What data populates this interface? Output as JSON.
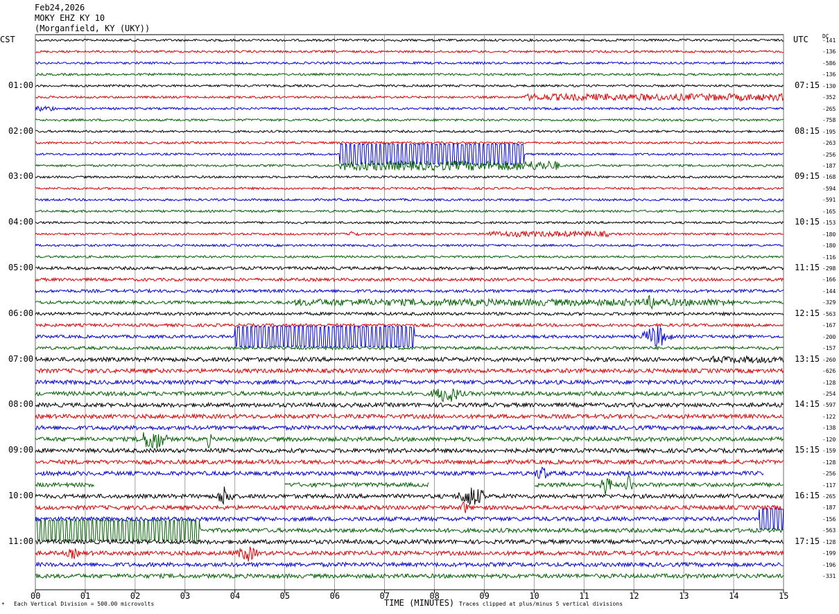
{
  "header": {
    "date": "Feb24,2026",
    "station": "MOKY EHZ KY 10",
    "location": "(Morganfield, KY (UKY))"
  },
  "left_tz": "CST",
  "right_tz": "UTC",
  "dc_label": "DC",
  "colors": [
    "#000000",
    "#e00000",
    "#0000e0",
    "#006000"
  ],
  "footer": {
    "xlabel": "TIME (MINUTES)",
    "scale_note": "Each Vertical Division =  500.00 microvolts",
    "clip_note": "Traces clipped at plus/minus 5 vertical divisions"
  },
  "chart_data": {
    "type": "line",
    "title": "MOKY EHZ KY 10",
    "xlabel": "TIME (MINUTES)",
    "xlim": [
      0,
      15
    ],
    "x_ticks": [
      "00",
      "01",
      "02",
      "03",
      "04",
      "05",
      "06",
      "07",
      "08",
      "09",
      "10",
      "11",
      "12",
      "13",
      "14",
      "15"
    ],
    "rows": 48,
    "left_hour_labels": [
      {
        "row": 4,
        "label": "01:00"
      },
      {
        "row": 8,
        "label": "02:00"
      },
      {
        "row": 12,
        "label": "03:00"
      },
      {
        "row": 16,
        "label": "04:00"
      },
      {
        "row": 20,
        "label": "05:00"
      },
      {
        "row": 24,
        "label": "06:00"
      },
      {
        "row": 28,
        "label": "07:00"
      },
      {
        "row": 32,
        "label": "08:00"
      },
      {
        "row": 36,
        "label": "09:00"
      },
      {
        "row": 40,
        "label": "10:00"
      },
      {
        "row": 44,
        "label": "11:00"
      }
    ],
    "right_hour_labels": [
      {
        "row": 4,
        "label": "07:15"
      },
      {
        "row": 8,
        "label": "08:15"
      },
      {
        "row": 12,
        "label": "09:15"
      },
      {
        "row": 16,
        "label": "10:15"
      },
      {
        "row": 20,
        "label": "11:15"
      },
      {
        "row": 24,
        "label": "12:15"
      },
      {
        "row": 28,
        "label": "13:15"
      },
      {
        "row": 32,
        "label": "14:15"
      },
      {
        "row": 36,
        "label": "15:15"
      },
      {
        "row": 40,
        "label": "16:15"
      },
      {
        "row": 44,
        "label": "17:15"
      }
    ],
    "dc_offsets": [
      "-141",
      "-136",
      "-586",
      "-136",
      "-130",
      "-352",
      "-265",
      "-758",
      "-195",
      "-263",
      "-256",
      "-187",
      "-168",
      "-594",
      "-591",
      "-165",
      "-153",
      "-180",
      "-180",
      "-116",
      "-298",
      "-166",
      "-144",
      "-329",
      "-563",
      "-167",
      "-200",
      "-157",
      "-260",
      "-626",
      "-128",
      "-254",
      "-597",
      "-122",
      "-138",
      "-120",
      "-159",
      "-128",
      "-256",
      "-117",
      "-265",
      "-187",
      "-156",
      "-563",
      "-128",
      "-199",
      "-196",
      "-331"
    ],
    "events": [
      {
        "row": 5,
        "start": 9.8,
        "end": 15,
        "amp": 5,
        "kind": "noise"
      },
      {
        "row": 6,
        "start": 0.0,
        "end": 0.4,
        "amp": 4,
        "kind": "noise"
      },
      {
        "row": 10,
        "start": 6.1,
        "end": 9.8,
        "amp": 16,
        "kind": "square"
      },
      {
        "row": 11,
        "start": 6.1,
        "end": 10.5,
        "amp": 7,
        "kind": "noise"
      },
      {
        "row": 17,
        "start": 6.3,
        "end": 6.5,
        "amp": 6,
        "kind": "burst"
      },
      {
        "row": 17,
        "start": 9.0,
        "end": 11.5,
        "amp": 4,
        "kind": "noise"
      },
      {
        "row": 23,
        "start": 5.2,
        "end": 14.0,
        "amp": 5,
        "kind": "noise"
      },
      {
        "row": 23,
        "start": 12.25,
        "end": 12.45,
        "amp": 14,
        "kind": "burst"
      },
      {
        "row": 26,
        "start": 4.0,
        "end": 7.6,
        "amp": 16,
        "kind": "square"
      },
      {
        "row": 26,
        "start": 12.1,
        "end": 12.8,
        "amp": 16,
        "kind": "burst"
      },
      {
        "row": 28,
        "start": 13.5,
        "end": 15,
        "amp": 5,
        "kind": "noise"
      },
      {
        "row": 31,
        "start": 7.9,
        "end": 8.6,
        "amp": 12,
        "kind": "burst"
      },
      {
        "row": 35,
        "start": 2.0,
        "end": 2.7,
        "amp": 16,
        "kind": "burst"
      },
      {
        "row": 35,
        "start": 3.4,
        "end": 3.55,
        "amp": 10,
        "kind": "burst"
      },
      {
        "row": 38,
        "start": 10.0,
        "end": 10.3,
        "amp": 10,
        "kind": "burst"
      },
      {
        "row": 38,
        "start": 14.6,
        "end": 15,
        "amp": 0,
        "kind": "gap"
      },
      {
        "row": 39,
        "start": 11.3,
        "end": 11.6,
        "amp": 14,
        "kind": "burst"
      },
      {
        "row": 39,
        "start": 11.8,
        "end": 12.0,
        "amp": 14,
        "kind": "burst"
      },
      {
        "row": 39,
        "start": 1.2,
        "end": 5.0,
        "amp": 0,
        "kind": "gap"
      },
      {
        "row": 39,
        "start": 7.9,
        "end": 10.0,
        "amp": 0,
        "kind": "gap"
      },
      {
        "row": 40,
        "start": 3.6,
        "end": 4.0,
        "amp": 14,
        "kind": "burst"
      },
      {
        "row": 40,
        "start": 8.4,
        "end": 9.1,
        "amp": 14,
        "kind": "burst"
      },
      {
        "row": 41,
        "start": 8.5,
        "end": 8.7,
        "amp": 8,
        "kind": "burst"
      },
      {
        "row": 42,
        "start": 14.5,
        "end": 15,
        "amp": 16,
        "kind": "square"
      },
      {
        "row": 43,
        "start": 0.0,
        "end": 3.3,
        "amp": 16,
        "kind": "square"
      },
      {
        "row": 45,
        "start": 4.0,
        "end": 4.5,
        "amp": 10,
        "kind": "burst"
      },
      {
        "row": 45,
        "start": 0.6,
        "end": 0.9,
        "amp": 6,
        "kind": "burst"
      }
    ],
    "grid": true,
    "legend": "none"
  }
}
